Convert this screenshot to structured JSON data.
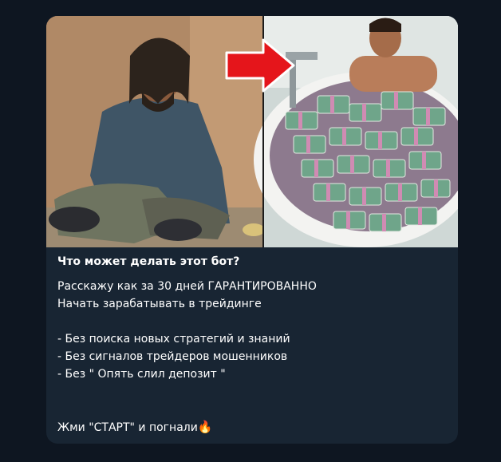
{
  "message": {
    "title": "Что может делать этот бот?",
    "intro_lines": [
      "Расскажу как за 30 дней ГАРАНТИРОВАННО",
      "Начать зарабатывать в трейдинге"
    ],
    "bullets": [
      "- Без поиска новых стратегий и знаний",
      "- Без сигналов трейдеров мошенников",
      "- Без \" Опять слил депозит \""
    ],
    "cta": "Жми \"СТАРТ\" и погнали",
    "cta_emoji": "🔥"
  },
  "colors": {
    "background": "#0e1621",
    "bubble": "#182533",
    "text": "#ffffff",
    "arrow": "#e5151b"
  },
  "media": {
    "left_image": "poor-man-photo",
    "right_image": "money-bathtub-photo",
    "center_icon": "red-arrow-icon"
  }
}
